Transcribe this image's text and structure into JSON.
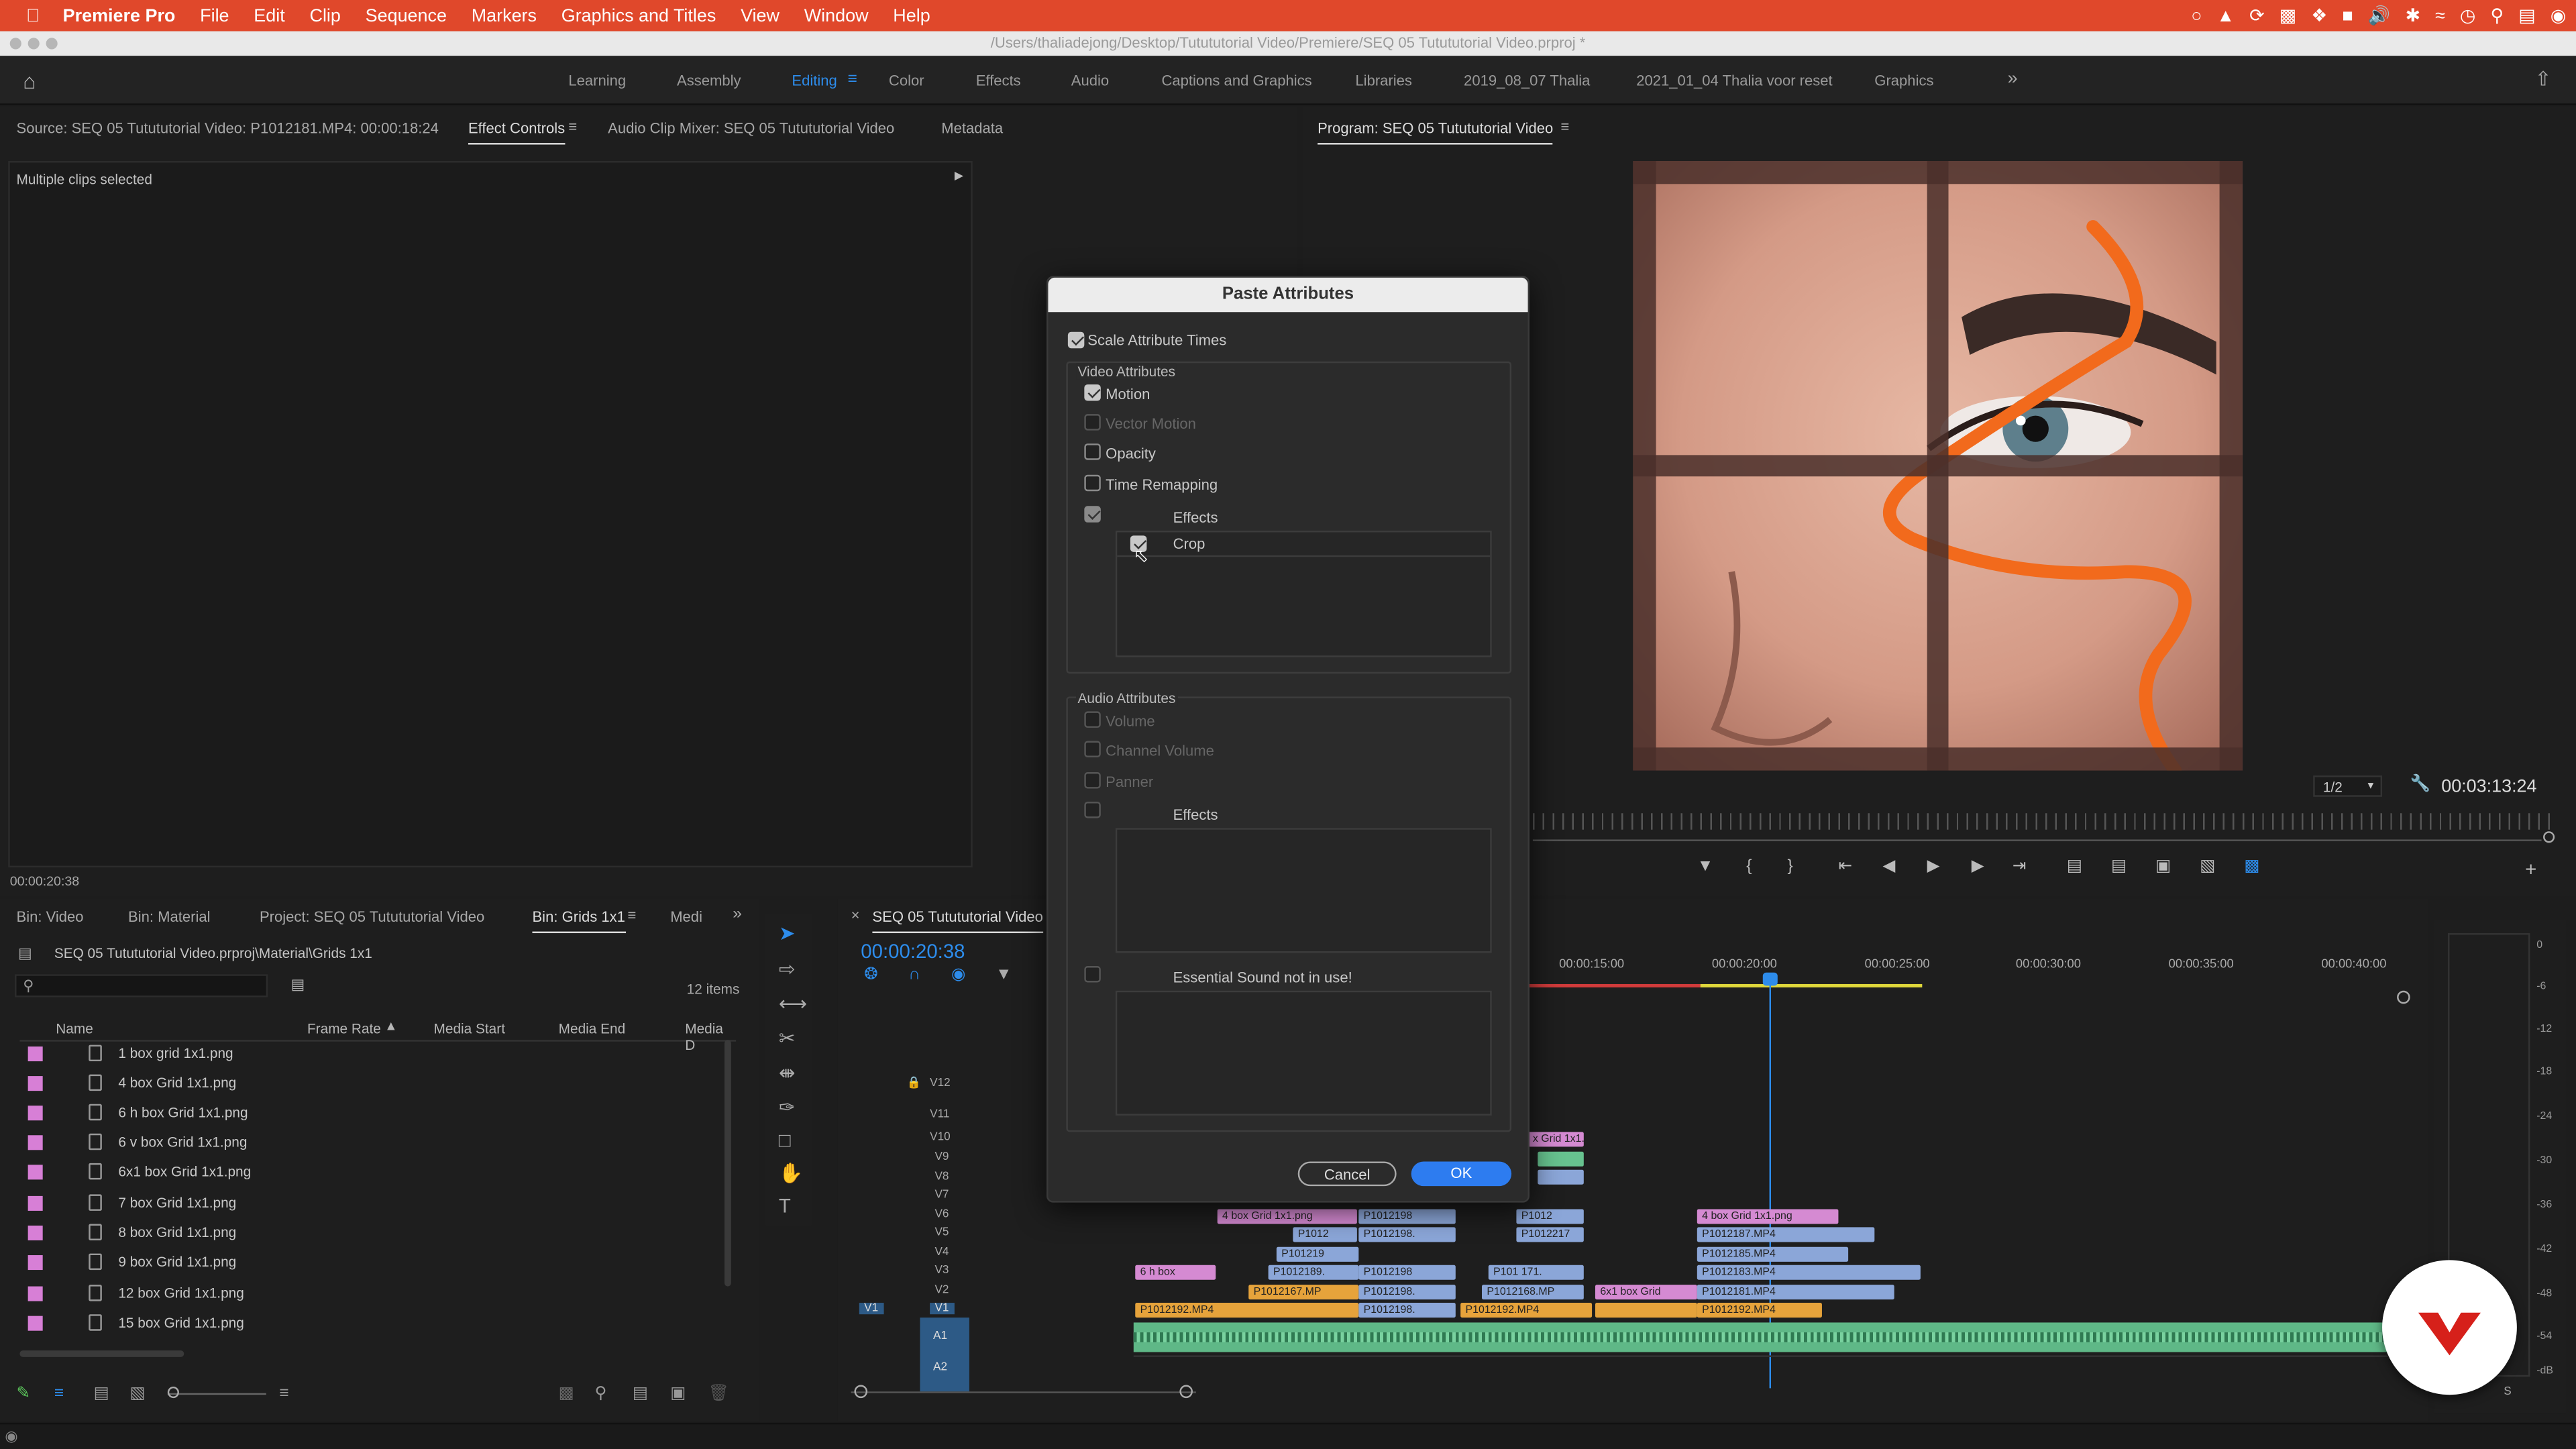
{
  "menubar": {
    "app": "Premiere Pro",
    "items": [
      "File",
      "Edit",
      "Clip",
      "Sequence",
      "Markers",
      "Graphics and Titles",
      "View",
      "Window",
      "Help"
    ]
  },
  "titlebar": {
    "path": "/Users/thaliadejong/Desktop/Tutututorial Video/Premiere/SEQ 05 Tutututorial Video.prproj *"
  },
  "workspaces": [
    "Learning",
    "Assembly",
    "Editing",
    "Color",
    "Effects",
    "Audio",
    "Captions and Graphics",
    "Libraries",
    "2019_08_07 Thalia",
    "2021_01_04 Thalia voor reset",
    "Graphics"
  ],
  "source_panel": {
    "tabs": [
      "Source: SEQ 05 Tutututorial Video: P1012181.MP4: 00:00:18:24",
      "Effect Controls",
      "Audio Clip Mixer: SEQ 05 Tutututorial Video",
      "Metadata"
    ],
    "message": "Multiple clips selected",
    "timecode": "00:00:20:38"
  },
  "program_panel": {
    "title": "Program: SEQ 05 Tutututorial Video",
    "zoom": "1/2",
    "timecode": "00:03:13:24"
  },
  "dialog": {
    "title": "Paste Attributes",
    "scale_times": "Scale Attribute Times",
    "video_header": "Video Attributes",
    "video_items": [
      "Motion",
      "Vector Motion",
      "Opacity",
      "Time Remapping"
    ],
    "effects": "Effects",
    "crop": "Crop",
    "audio_header": "Audio Attributes",
    "audio_items": [
      "Volume",
      "Channel Volume",
      "Panner"
    ],
    "audio_effects": "Effects",
    "essential": "Essential Sound not in use!",
    "cancel": "Cancel",
    "ok": "OK"
  },
  "project_panel": {
    "tabs": [
      "Bin: Video",
      "Bin: Material",
      "Project: SEQ 05 Tutututorial Video",
      "Bin: Grids 1x1",
      "Medi"
    ],
    "path": "SEQ 05 Tutututorial Video.prproj\\Material\\Grids 1x1",
    "item_count": "12 items",
    "columns": [
      "Name",
      "Frame Rate",
      "Media Start",
      "Media End",
      "Media D"
    ],
    "items": [
      "1 box grid 1x1.png",
      "4 box Grid 1x1.png",
      "6 h box Grid 1x1.png",
      "6 v box Grid 1x1.png",
      "6x1 box Grid 1x1.png",
      "7 box Grid 1x1.png",
      "8 box Grid 1x1.png",
      "9 box Grid 1x1.png",
      "12 box Grid 1x1.png",
      "15 box Grid 1x1.png"
    ]
  },
  "timeline": {
    "title": "SEQ 05 Tutututorial Video",
    "timecode": "00:00:20:38",
    "ruler": [
      "00:00:15:00",
      "00:00:20:00",
      "00:00:25:00",
      "00:00:30:00",
      "00:00:35:00",
      "00:00:40:00"
    ],
    "video_tracks": [
      "V12",
      "V11",
      "V10",
      "V9",
      "V8",
      "V7",
      "V6",
      "V5",
      "V4",
      "V3",
      "V2",
      "V1"
    ],
    "audio_tracks": [
      "A1",
      "A2"
    ],
    "source_patch": "V1",
    "clips": {
      "c1": "x Grid 1x1.",
      "c2": "4 box Grid 1x1.png",
      "c3": "P1012",
      "c4": "P1012198",
      "c5": "P1012198.",
      "c6": "P1012",
      "c7": "P1012198.",
      "c8": "P1012217",
      "c9": "P101219",
      "c10": "6 h box",
      "c11": "P1012189.",
      "c12": "P1012198",
      "c13": "P101 171.",
      "c14": "P1012167.MP",
      "c15": "P1012198.",
      "c16": "P1012168.MP",
      "c17": "6x1 box Grid",
      "c18": "P1012192.MP4",
      "c19": "P1012198.",
      "c20": "P1012192.MP4",
      "c21": "4 box Grid 1x1.png",
      "c22": "P1012187.MP4",
      "c23": "P1012185.MP4",
      "c24": "P1012183.MP4",
      "c25": "P1012181.MP4",
      "c26": "P1012192.MP4"
    }
  },
  "audio_meter": {
    "scale": [
      "0",
      "-6",
      "-12",
      "-18",
      "-24",
      "-30",
      "-36",
      "-42",
      "-48",
      "-54",
      "-dB"
    ],
    "solo": "S"
  },
  "colors": {
    "accent": "#2d8ceb",
    "menubar": "#e0482b",
    "clip_pink": "#d58ad2",
    "clip_blue": "#8ba6d8",
    "clip_orange": "#e6a33b",
    "audio_green": "#67c28f"
  }
}
